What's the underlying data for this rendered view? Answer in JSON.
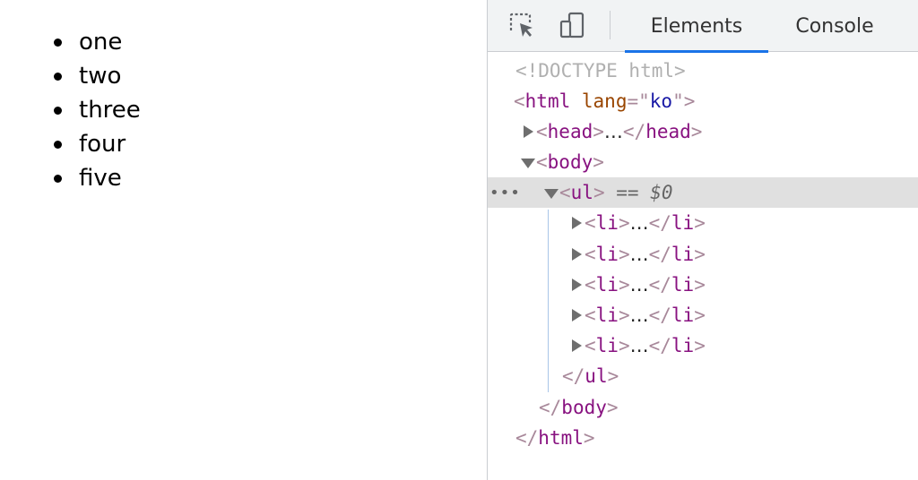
{
  "page": {
    "list_items": [
      "one",
      "two",
      "three",
      "four",
      "five"
    ]
  },
  "devtools": {
    "toolbar": {
      "inspect_icon": "inspect-element-icon",
      "device_icon": "device-toolbar-icon",
      "tabs": [
        {
          "label": "Elements",
          "active": true
        },
        {
          "label": "Console",
          "active": false
        }
      ]
    },
    "dom": {
      "doctype": "<!DOCTYPE html>",
      "html_open_tag": "html",
      "lang_attr_name": "lang",
      "lang_attr_value": "ko",
      "head_tag": "head",
      "body_tag": "body",
      "ul_tag": "ul",
      "li_tag": "li",
      "ellipsis": "…",
      "selected_marker_eq": "==",
      "selected_marker_var": "$0",
      "row_dots": "•••"
    }
  },
  "colors": {
    "tag_name": "#881280",
    "attr_name": "#994500",
    "attr_value": "#1a1aa6",
    "active_tab_underline": "#1a73e8",
    "selected_row_bg": "#e0e0e0"
  }
}
